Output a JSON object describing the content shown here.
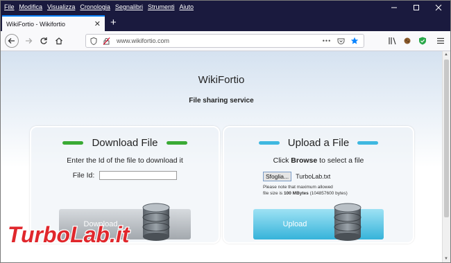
{
  "menu": [
    "File",
    "Modifica",
    "Visualizza",
    "Cronologia",
    "Segnalibri",
    "Strumenti",
    "Aiuto"
  ],
  "tab": {
    "title": "WikiFortio - Wikifortio"
  },
  "urlbar": {
    "url": "www.wikifortio.com"
  },
  "site": {
    "title": "WikiFortio",
    "subtitle": "File sharing service"
  },
  "download": {
    "title": "Download File",
    "instruction": "Enter the Id of the file to download it",
    "field_label": "File Id:",
    "field_value": "",
    "button_label": "Download",
    "accent": "#3aaa35"
  },
  "upload": {
    "title": "Upload a File",
    "instruction_pre": "Click",
    "instruction_bold": "Browse",
    "instruction_post": "to select a file",
    "browse_label": "Sfoglia...",
    "selected_file": "TurboLab.txt",
    "note_line1": "Please note that maximum allowed",
    "note_line2_pre": "file size is",
    "note_line2_bold": "100 MBytes",
    "note_line2_post": "(104857600 bytes)",
    "button_label": "Upload",
    "accent": "#3fb8e0"
  },
  "watermark": {
    "text": "TurboLab.it"
  }
}
